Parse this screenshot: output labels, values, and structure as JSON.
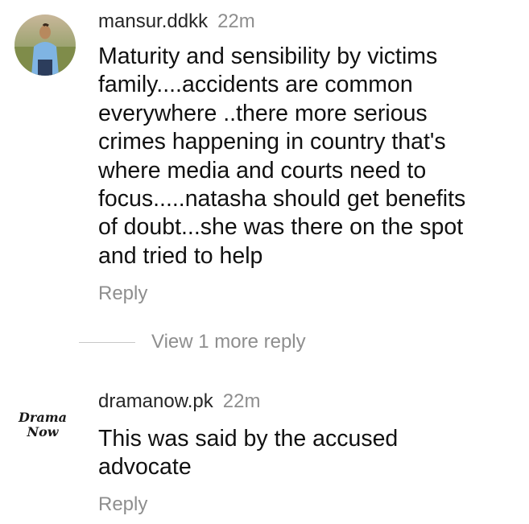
{
  "comments": [
    {
      "username": "mansur.ddkk",
      "time": "22m",
      "text_lines": [
        "Maturity and sensibility by victims",
        "family....accidents are common",
        "everywhere ..there more serious",
        "crimes happening in country that's",
        "where media and courts need to",
        "focus.....natasha should get benefits",
        "of doubt...she was there on the spot",
        "and tried to help"
      ],
      "reply_label": "Reply",
      "avatar_icon": "profile-photo"
    },
    {
      "username": "dramanow.pk",
      "time": "22m",
      "text_lines": [
        "This was said by the accused",
        "advocate"
      ],
      "reply_label": "Reply",
      "avatar_logo_lines": [
        "Drama",
        "Now"
      ]
    }
  ],
  "view_more_label": "View 1 more reply",
  "colors": {
    "text": "#111111",
    "secondary": "#8e8e8e",
    "divider": "#c7c7c7"
  }
}
